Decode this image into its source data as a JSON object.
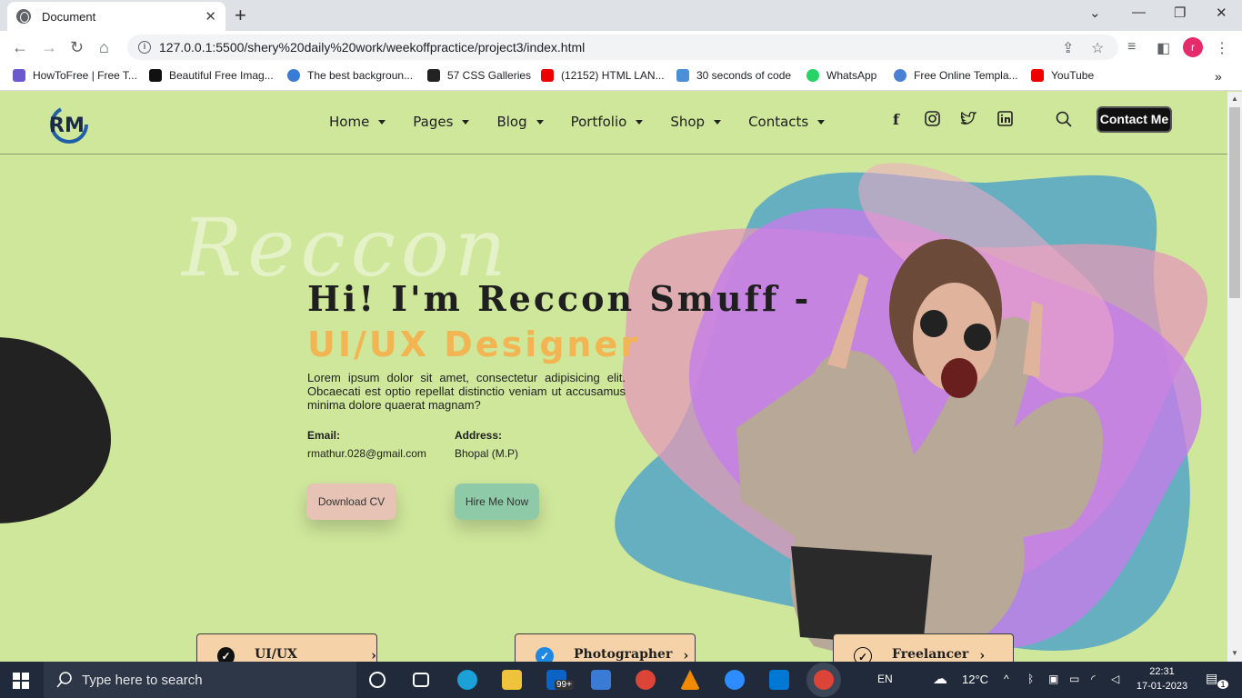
{
  "browser": {
    "tab_title": "Document",
    "url": "127.0.0.1:5500/shery%20daily%20work/weekoffpractice/project3/index.html",
    "profile_initial": "r",
    "bookmarks": [
      "HowToFree | Free T...",
      "Beautiful Free Imag...",
      "The best backgroun...",
      "57 CSS Galleries",
      "(12152) HTML LAN...",
      "30 seconds of code",
      "WhatsApp",
      "Free Online Templa...",
      "YouTube"
    ]
  },
  "site": {
    "logo_text": "RM",
    "nav": [
      "Home",
      "Pages",
      "Blog",
      "Portfolio",
      "Shop",
      "Contacts"
    ],
    "social_icons": [
      "facebook-icon",
      "instagram-icon",
      "twitter-icon",
      "linkedin-icon"
    ],
    "contact_button": "Contact Me",
    "watermark": "Reccon",
    "headline": "Hi! I'm Reccon Smuff -",
    "role": "UI/UX Designer",
    "description": "Lorem ipsum dolor sit amet, consectetur adipisicing elit. Obcaecati est optio repellat distinctio veniam ut accusamus minima dolore quaerat magnam?",
    "email_label": "Email:",
    "email_value": "rmathur.028@gmail.com",
    "address_label": "Address:",
    "address_value": "Bhopal (M.P)",
    "download_cv": "Download CV",
    "hire_me": "Hire Me Now",
    "cards": [
      "UI/UX Designer",
      "Photographer",
      "Freelancer"
    ],
    "colors": {
      "background": "#cfe79b",
      "accent": "#f2b552",
      "dark": "#1f1f1f"
    }
  },
  "taskbar": {
    "search_placeholder": "Type here to search",
    "lang": "EN",
    "weather": "12°C",
    "time": "22:31",
    "date": "17-01-2023",
    "mail_badge": "99+",
    "notification_count": "1"
  }
}
